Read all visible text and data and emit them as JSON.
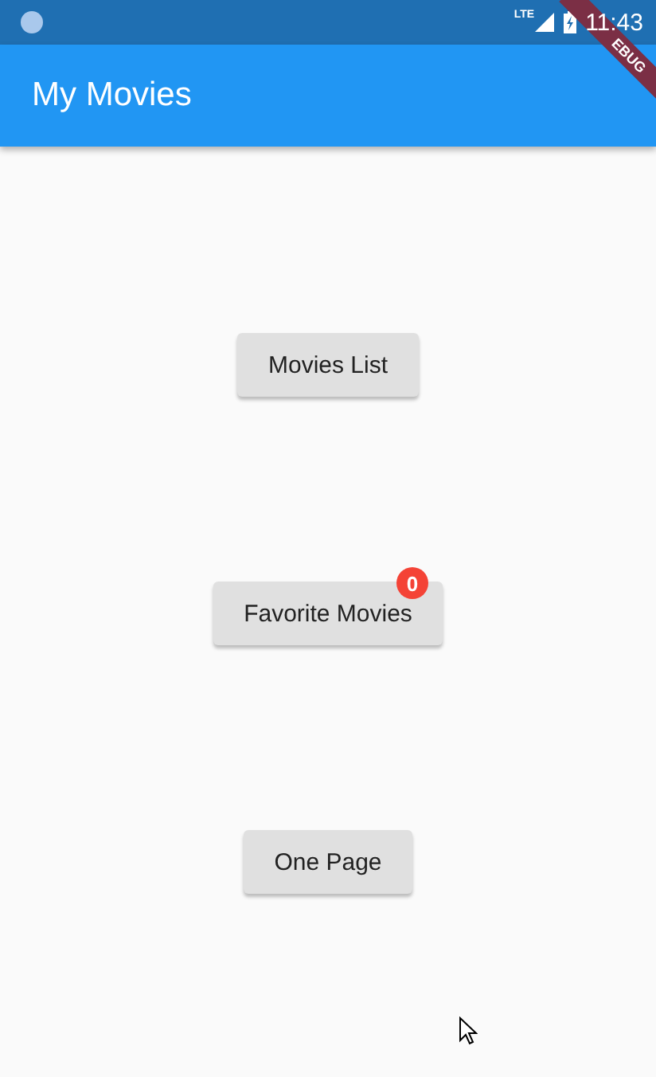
{
  "status_bar": {
    "network": "LTE",
    "time": "11:43"
  },
  "debug_banner": {
    "label": "EBUG"
  },
  "app_bar": {
    "title": "My Movies"
  },
  "buttons": [
    {
      "label": "Movies List"
    },
    {
      "label": "Favorite Movies",
      "badge": "0"
    },
    {
      "label": "One Page"
    }
  ]
}
